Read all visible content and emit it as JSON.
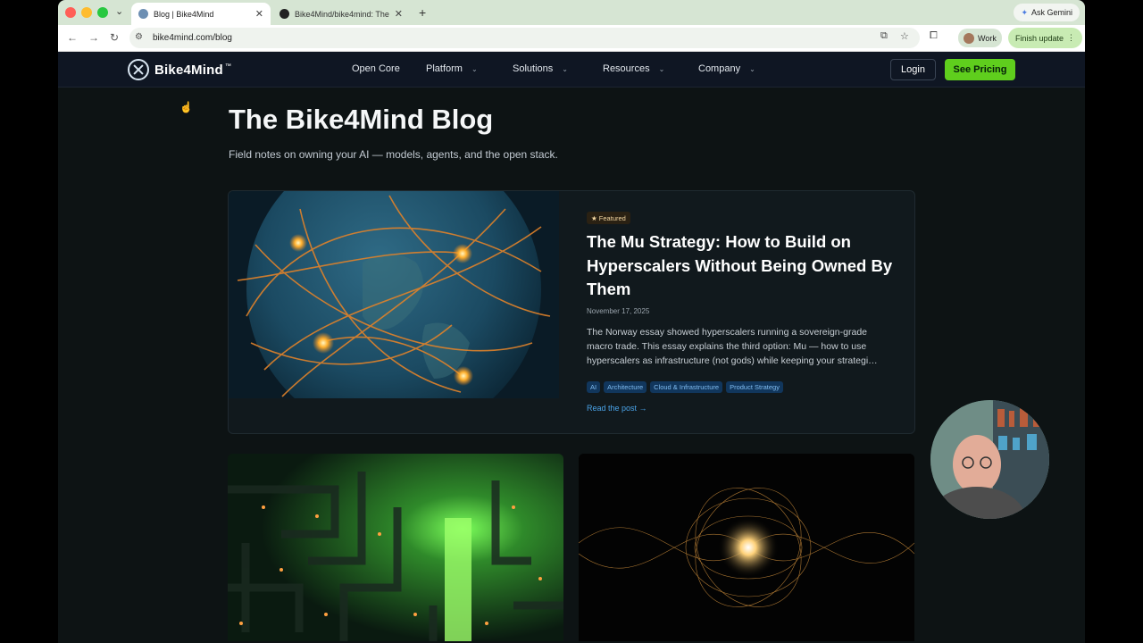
{
  "browser": {
    "tabs": [
      {
        "title": "Blog | Bike4Mind",
        "active": true
      },
      {
        "title": "Bike4Mind/bike4mind: The op",
        "active": false
      }
    ],
    "gemini_label": "Ask Gemini",
    "url": "bike4mind.com/blog",
    "profile_label": "Work",
    "finish_update_label": "Finish update"
  },
  "site": {
    "logo_text": "Bike4Mind",
    "nav": [
      {
        "label": "Open Core",
        "has_dropdown": false
      },
      {
        "label": "Platform",
        "has_dropdown": true
      },
      {
        "label": "Solutions",
        "has_dropdown": true
      },
      {
        "label": "Resources",
        "has_dropdown": true
      },
      {
        "label": "Company",
        "has_dropdown": true
      }
    ],
    "login_label": "Login",
    "pricing_label": "See Pricing",
    "accent_color": "#5fce1d"
  },
  "blog": {
    "title": "The Bike4Mind Blog",
    "subtitle": "Field notes on owning your AI — models, agents, and the open stack.",
    "featured": {
      "badge": "★ Featured",
      "title": "The Mu Strategy: How to Build on Hyperscalers Without Being Owned By Them",
      "date": "November 17, 2025",
      "excerpt": "The Norway essay showed hyperscalers running a sovereign-grade macro trade. This essay explains the third option: Mu — how to use hyperscalers as infrastructure (not gods) while keeping your strategi…",
      "tags": [
        "AI",
        "Architecture",
        "Cloud & Infrastructure",
        "Product Strategy"
      ],
      "read_label": "Read the post →"
    }
  }
}
